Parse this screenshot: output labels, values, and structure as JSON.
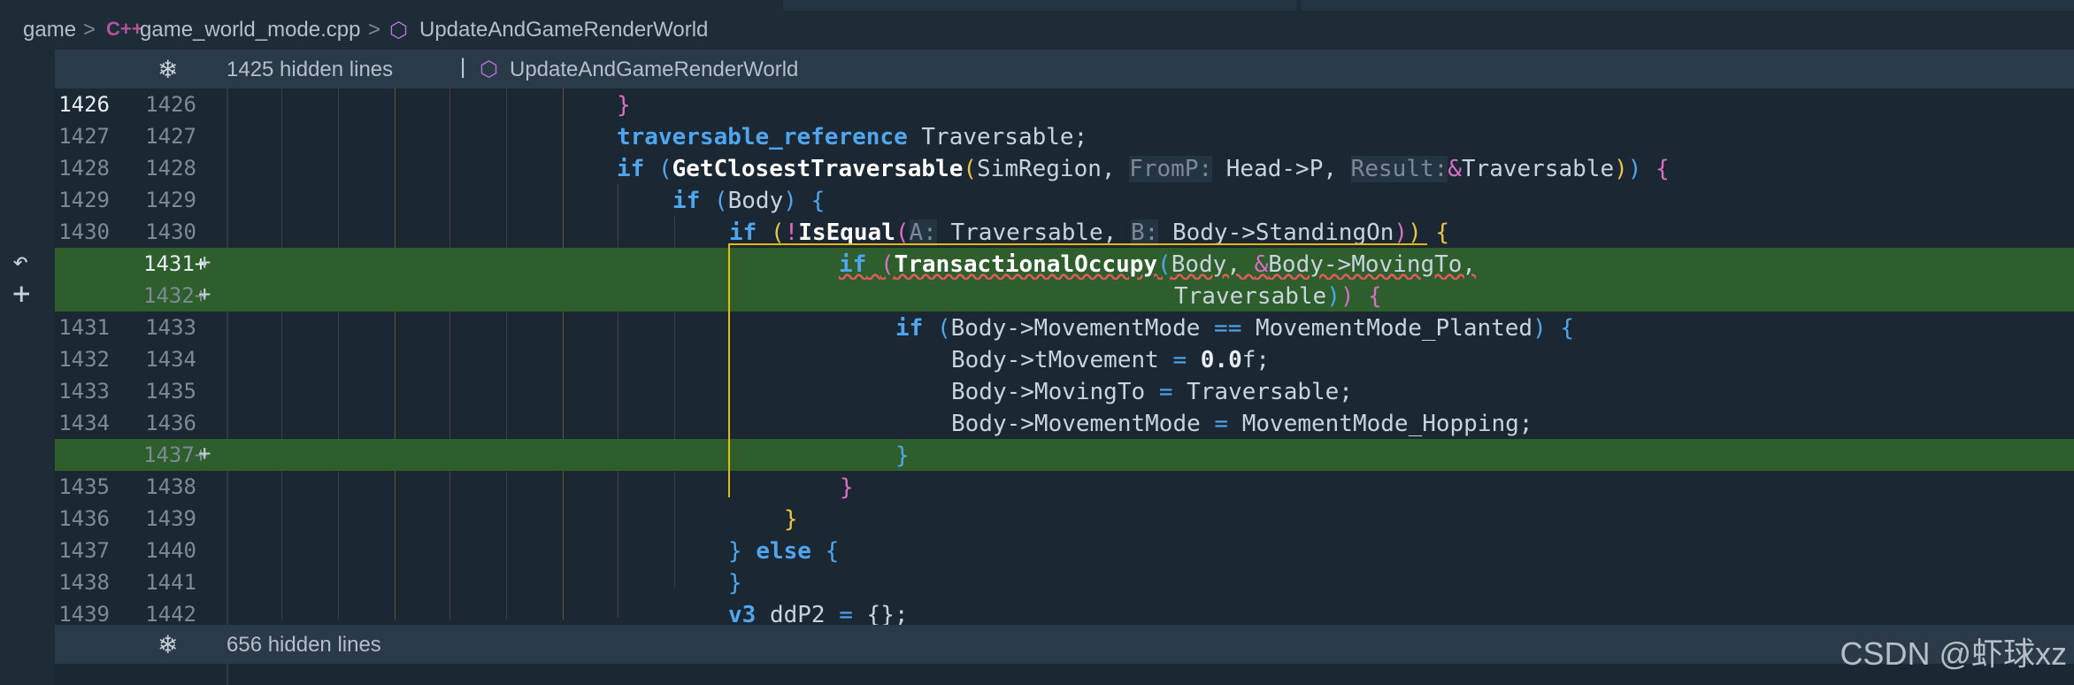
{
  "breadcrumb": {
    "items": [
      "game",
      "game_world_mode.cpp",
      "UpdateAndGameRenderWorld"
    ],
    "cpp_icon": "C++",
    "sep": ">"
  },
  "fold_top": {
    "text": "1425 hidden lines",
    "pipe": "|",
    "symbol": "UpdateAndGameRenderWorld"
  },
  "fold_bottom": {
    "text": "656 hidden lines"
  },
  "gutter_icons": [
    "undo-icon",
    "plus-icon"
  ],
  "lines": [
    {
      "old": "1426",
      "new": "1426"
    },
    {
      "old": "1427",
      "new": "1427"
    },
    {
      "old": "1428",
      "new": "1428"
    },
    {
      "old": "1429",
      "new": "1429"
    },
    {
      "old": "1430",
      "new": "1430"
    },
    {
      "old": "",
      "new": "1431+"
    },
    {
      "old": "",
      "new": "1432+"
    },
    {
      "old": "1431",
      "new": "1433"
    },
    {
      "old": "1432",
      "new": "1434"
    },
    {
      "old": "1433",
      "new": "1435"
    },
    {
      "old": "1434",
      "new": "1436"
    },
    {
      "old": "",
      "new": "1437+"
    },
    {
      "old": "1435",
      "new": "1438"
    },
    {
      "old": "1436",
      "new": "1439"
    },
    {
      "old": "1437",
      "new": "1440"
    },
    {
      "old": "1438",
      "new": "1441"
    },
    {
      "old": "1439",
      "new": "1442"
    }
  ],
  "code": {
    "l0": "}",
    "l1_type": "traversable_reference",
    "l1_rest": " Traversable;",
    "l2_if": "if",
    "l2_fn": "GetClosestTraversable",
    "l2_a": "SimRegion, ",
    "l2_h1": "FromP:",
    "l2_b": " Head->P, ",
    "l2_h2": "Result:",
    "l2_c": "Traversable",
    "l3_if": "if",
    "l3_a": "Body",
    "l4_if": "if",
    "l4_fn": "IsEqual",
    "l4_h1": "A:",
    "l4_a": " Traversable, ",
    "l4_h2": "B:",
    "l4_b": " Body->StandingOn",
    "l5_if": "if",
    "l5_fn": "TransactionalOccupy",
    "l5_a": "Body, ",
    "l5_b": "Body->MovingTo,",
    "l6_a": "Traversable",
    "l7_if": "if",
    "l7_a": "Body->MovementMode ",
    "l7_op": "==",
    "l7_b": " MovementMode_Planted",
    "l8_a": "Body->tMovement ",
    "l8_op": "=",
    "l8_num": "0.0",
    "l8_b": "f;",
    "l9_a": "Body->MovingTo ",
    "l9_op": "=",
    "l9_b": " Traversable;",
    "l10_a": "Body->MovementMode ",
    "l10_op": "=",
    "l10_b": " MovementMode_Hopping;",
    "l11": "}",
    "l12": "}",
    "l13": "}",
    "l14_a": "} ",
    "l14_kw": "else",
    "l15": "}",
    "l16_type": "v3",
    "l16_a": " ddP2 ",
    "l16_op": "=",
    "l16_b": " {};"
  },
  "watermark": "CSDN @虾球xz",
  "colors": {
    "added_bg": "#2e5e2b",
    "keyword": "#4fa6ee",
    "box": "#e6b800"
  }
}
